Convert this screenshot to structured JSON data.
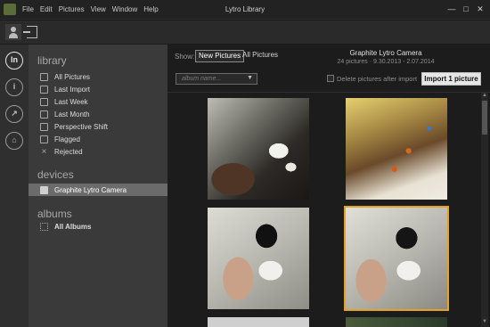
{
  "app": {
    "title": "Lytro Library"
  },
  "menu": [
    "File",
    "Edit",
    "Pictures",
    "View",
    "Window",
    "Help"
  ],
  "window_controls": {
    "minimize": "—",
    "maximize": "□",
    "close": "✕"
  },
  "rail": {
    "library_glyph": "ln",
    "info_glyph": "i",
    "share_glyph": "↗",
    "chat_glyph": "⌂"
  },
  "sidebar": {
    "library_heading": "library",
    "library_items": [
      {
        "label": "All Pictures",
        "icon": "pictures-icon"
      },
      {
        "label": "Last Import",
        "icon": "import-icon"
      },
      {
        "label": "Last Week",
        "icon": "calendar-icon"
      },
      {
        "label": "Last Month",
        "icon": "calendar-icon"
      },
      {
        "label": "Perspective Shift",
        "icon": "cube-icon"
      },
      {
        "label": "Flagged",
        "icon": "flag-icon"
      },
      {
        "label": "Rejected",
        "icon": "x-icon"
      }
    ],
    "devices_heading": "devices",
    "device_item": {
      "label": "Graphite Lytro Camera",
      "icon": "camera-icon"
    },
    "albums_heading": "albums",
    "albums_item": {
      "label": "All Albums",
      "icon": "grid-icon"
    }
  },
  "main": {
    "show_label": "Show:",
    "filter_new": "New Pictures",
    "filter_all": "All Pictures",
    "camera_title": "Graphite Lytro Camera",
    "camera_sub": "24 pictures · 9.30.2013 - 2.07.2014",
    "album_placeholder": "album name...",
    "delete_label": "Delete pictures after import",
    "import_button": "Import 1 picture"
  },
  "colors": {
    "selection_outline": "#e2a32a",
    "sidebar_bg": "#3a3a3a",
    "main_bg": "#1c1c1c"
  }
}
